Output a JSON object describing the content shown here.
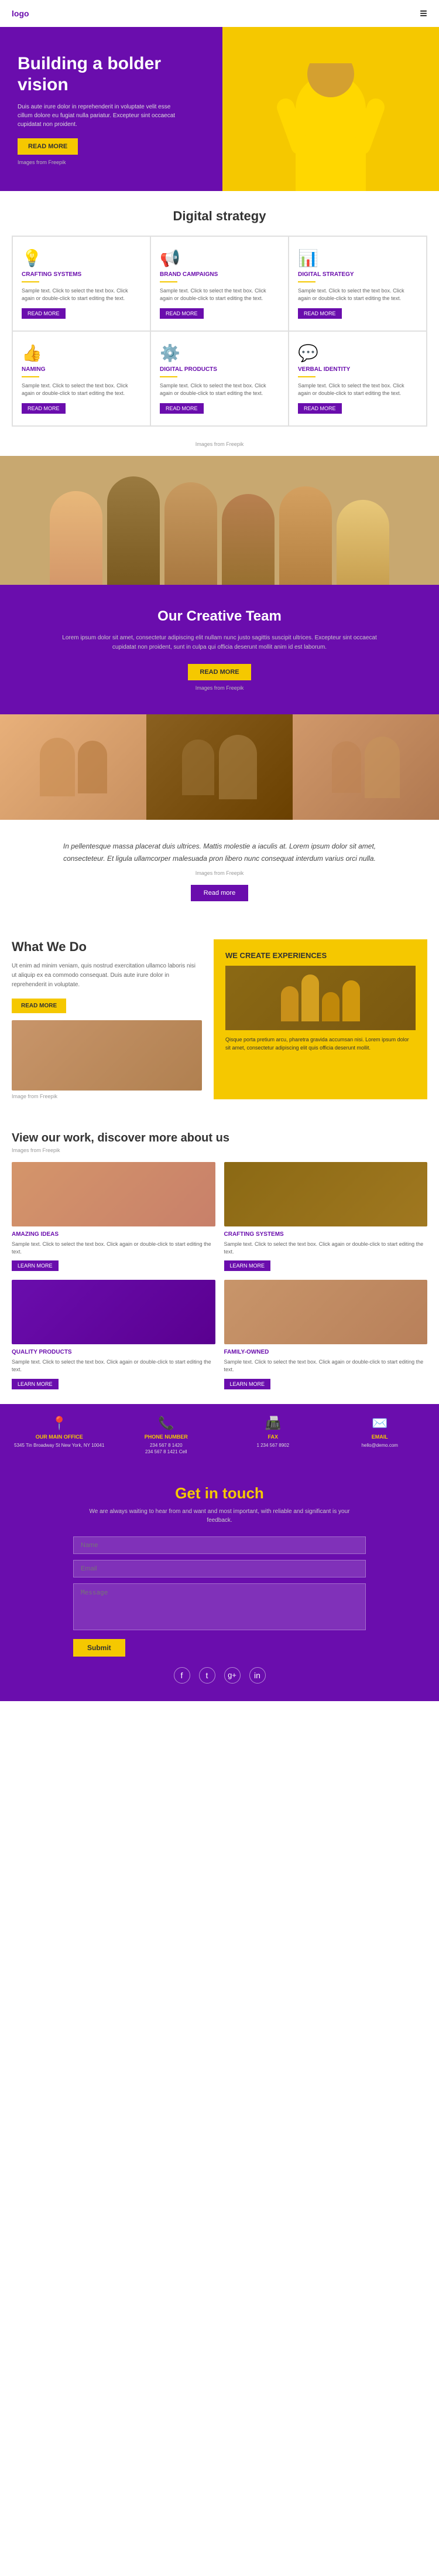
{
  "nav": {
    "logo": "logo",
    "hamburger_icon": "≡"
  },
  "hero": {
    "title": "Building a bolder vision",
    "description": "Duis aute irure dolor in reprehenderit in voluptate velit esse cillum dolore eu fugiat nulla pariatur. Excepteur sint occaecat cupidatat non proident.",
    "cta_label": "READ MORE",
    "credit": "Images from Freepik"
  },
  "digital_strategy": {
    "section_title": "Digital strategy",
    "cards": [
      {
        "icon": "💡",
        "title": "CRAFTING SYSTEMS",
        "text": "Sample text. Click to select the text box. Click again or double-click to start editing the text.",
        "btn": "READ MORE"
      },
      {
        "icon": "📢",
        "title": "BRAND CAMPAIGNS",
        "text": "Sample text. Click to select the text box. Click again or double-click to start editing the text.",
        "btn": "READ MORE"
      },
      {
        "icon": "📊",
        "title": "DIGITAL STRATEGY",
        "text": "Sample text. Click to select the text box. Click again or double-click to start editing the text.",
        "btn": "READ MORE"
      },
      {
        "icon": "👍",
        "title": "NAMING",
        "text": "Sample text. Click to select the text box. Click again or double-click to start editing the text.",
        "btn": "READ MORE"
      },
      {
        "icon": "⚙️",
        "title": "DIGITAL PRODUCTS",
        "text": "Sample text. Click to select the text box. Click again or double-click to start editing the text.",
        "btn": "READ MORE"
      },
      {
        "icon": "💬",
        "title": "VERBAL IDENTITY",
        "text": "Sample text. Click to select the text box. Click again or double-click to start editing the text.",
        "btn": "READ MORE"
      }
    ],
    "credit": "Images from Freepik"
  },
  "creative_team": {
    "title": "Our Creative Team",
    "description": "Lorem ipsum dolor sit amet, consectetur adipiscing elit nullam nunc justo sagittis suscipit ultrices. Excepteur sint occaecat cupidatat non proident, sunt in culpa qui officia deserunt mollit anim id est laborum.",
    "cta_label": "READ MORE",
    "credit": "Images from Freepik"
  },
  "quote": {
    "text": "In pellentesque massa placerat duis ultrices. Mattis molestie a iaculis at. Lorem ipsum dolor sit amet, consecteteur. Et ligula ullamcorper malesuada pron libero nunc consequat interdum varius orci nulla.",
    "credit": "Images from Freepik",
    "btn_label": "Read more"
  },
  "what_we_do": {
    "title": "What We Do",
    "description": "Ut enim ad minim veniam, quis nostrud exercitation ullamco laboris nisi ut aliquip ex ea commodo consequat. Duis aute irure dolor in reprehenderit in voluptate.",
    "btn_label": "READ MORE",
    "credit": "Image from Freepik",
    "right_title": "WE CREATE EXPERIENCES",
    "right_text": "Qisque porta pretium arcu, pharetra gravida accumsan nisi. Lorem ipsum dolor sit amet, consectetur adipiscing elit quis officia deserunt mollit."
  },
  "view_work": {
    "title": "View our work, discover more about us",
    "credit": "Images from Freepik",
    "cards": [
      {
        "title": "AMAZING IDEAS",
        "text": "Sample text. Click to select the text box. Click again or double-click to start editing the text.",
        "btn": "LEARN MORE"
      },
      {
        "title": "CRAFTING SYSTEMS",
        "text": "Sample text. Click to select the text box. Click again or double-click to start editing the text.",
        "btn": "LEARN MORE"
      },
      {
        "title": "QUALITY PRODUCTS",
        "text": "Sample text. Click to select the text box. Click again or double-click to start editing the text.",
        "btn": "LEARN MORE"
      },
      {
        "title": "FAMILY-OWNED",
        "text": "Sample text. Click to select the text box. Click again or double-click to start editing the text.",
        "btn": "LEARN MORE"
      }
    ]
  },
  "footer_info": {
    "items": [
      {
        "icon": "📍",
        "title": "OUR MAIN OFFICE",
        "text": "5345 Tin Broadway St New York, NY 10041"
      },
      {
        "icon": "📞",
        "title": "PHONE NUMBER",
        "text": "234 567 8 1420\n234 567 8 1421 Cell"
      },
      {
        "icon": "📠",
        "title": "FAX",
        "text": "1 234 567 8902"
      },
      {
        "icon": "✉️",
        "title": "EMAIL",
        "text": "hello@demo.com"
      }
    ]
  },
  "get_in_touch": {
    "title": "Get in touch",
    "description": "We are always waiting to hear from and want and most important, with reliable and significant is your feedback.",
    "name_placeholder": "Name",
    "email_placeholder": "Email",
    "message_placeholder": "Message",
    "submit_label": "Submit",
    "social": [
      "f",
      "t",
      "g+",
      "in"
    ]
  }
}
